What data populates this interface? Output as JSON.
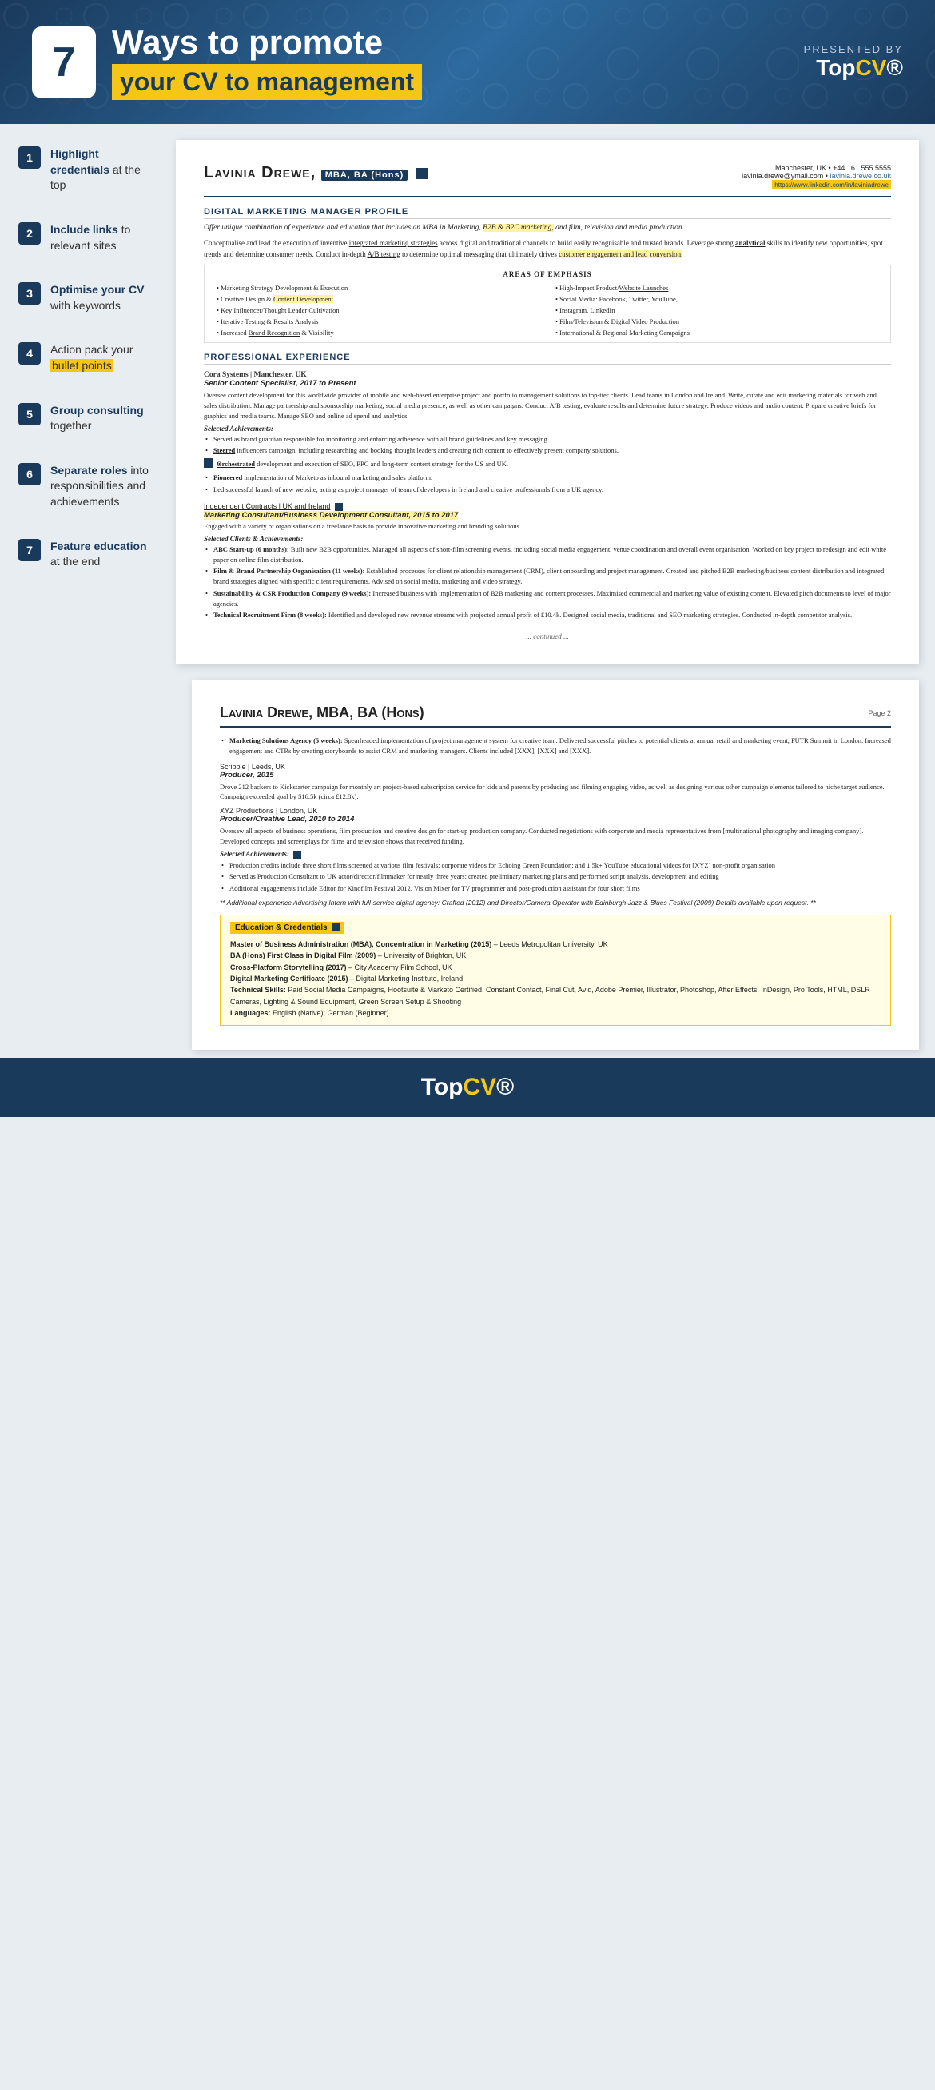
{
  "header": {
    "number": "7",
    "title": "Ways to promote",
    "subtitle": "your CV to management",
    "presented_by": "PRESENTED BY",
    "logo": "TopCV"
  },
  "tips": [
    {
      "number": "1",
      "text_prefix": "Highlight credentials",
      "text_suffix": " at the top"
    },
    {
      "number": "2",
      "text_prefix": "Include links",
      "text_suffix": " to relevant sites"
    },
    {
      "number": "3",
      "text_prefix": "Optimise your CV",
      "text_suffix": " with keywords"
    },
    {
      "number": "4",
      "text_prefix": "Action pack your ",
      "text_highlight": "bullet points"
    },
    {
      "number": "5",
      "text_prefix": "Group consulting",
      "text_suffix": " together"
    },
    {
      "number": "6",
      "text_prefix": "Separate roles",
      "text_suffix": " into responsibilities and achievements"
    },
    {
      "number": "7",
      "text_prefix": "Feature education",
      "text_suffix": " at the end"
    }
  ],
  "cv_page1": {
    "name_part1": "Lavinia Drewe,",
    "name_mba": "MBA, BA (Hons)",
    "contact_line1": "Manchester, UK • +44 161 555 5555",
    "contact_line2": "lavinia.drewe@ymail.com •",
    "contact_link1": "lavinia.drewe.co.uk",
    "contact_link2": "https://www.linkedin.com/in/laviniadrewe",
    "profile_title": "DIGITAL MARKETING MANAGER PROFILE",
    "profile_intro": "Offer unique combination of experience and education that includes an MBA in Marketing, B2B & B2C marketing, and film, television and media production.",
    "profile_body": "Conceptualise and lead the execution of inventive integrated marketing strategies across digital and traditional channels to build easily recognisable and trusted brands. Leverage strong analytical skills to identify new opportunities, spot trends and determine consumer needs. Conduct in-depth A/B testing to determine optimal messaging that ultimately drives customer engagement and lead conversion.",
    "areas_title": "Areas of Emphasis",
    "areas": [
      "Marketing Strategy Development & Execution",
      "High-Impact Product/Website Launches",
      "Creative Design & Content Development",
      "Social Media: Facebook, Twitter, YouTube,",
      "Key Influencer/Thought Leader Cultivation",
      "Instagram, LinkedIn",
      "Iterative Testing & Results Analysis",
      "Film/Television & Digital Video Production",
      "Increased Brand Recognition & Visibility",
      "International & Regional Marketing Campaigns"
    ],
    "prof_exp_title": "Professional Experience",
    "job1_company": "Cora Systems | Manchester, UK",
    "job1_title": "Senior Content Specialist, 2017 to Present",
    "job1_desc": "Oversee content development for this worldwide provider of mobile and web-based enterprise project and portfolio management solutions to top-tier clients. Lead teams in London and Ireland. Write, curate and edit marketing materials for web and sales distribution. Manage partnership and sponsorship marketing, social media presence, as well as other campaigns. Conduct A/B testing, evaluate results and determine future strategy. Produce videos and audio content. Prepare creative briefs for graphics and media teams. Manage SEO and online ad spend and analytics.",
    "job1_achievements_label": "Selected Achievements:",
    "job1_achievements": [
      "Served as brand guardian responsible for monitoring and enforcing adherence with all brand guidelines and key messaging.",
      "Steered influencers campaign, including researching and booking thought leaders and creating rich content to effectively present company solutions.",
      "Orchestrated development and execution of SEO, PPC and long-term content strategy for the US and UK.",
      "Pioneered implementation of Marketo as inbound marketing and sales platform.",
      "Led successful launch of new website, acting as project manager of team of developers in Ireland and creative professionals from a UK agency."
    ],
    "job2_location": "Independent Contracts | UK and Ireland",
    "job2_title": "Marketing Consultant/Business Development Consultant, 2015 to 2017",
    "job2_desc": "Engaged with a variety of organisations on a freelance basis to provide innovative marketing and branding solutions.",
    "job2_clients_label": "Selected Clients & Achievements:",
    "job2_clients": [
      "ABC Start-up (6 months): Built new B2B opportunities. Managed all aspects of short-film screening events, including social media engagement, venue coordination and overall event organisation. Worked on key project to redesign and edit white paper on online film distribution.",
      "Film & Brand Partnership Organisation (11 weeks): Established processes for client relationship management (CRM), client onboarding and project management. Created and pitched B2B marketing/business content distribution and integrated brand strategies aligned with specific client requirements. Advised on social media, marketing and video strategy.",
      "Sustainability & CSR Production Company (9 weeks): Increased business with implementation of B2B marketing and content processes. Maximised commercial and marketing value of existing content. Elevated pitch documents to level of major agencies.",
      "Technical Recruitment Firm (8 weeks): Identified and developed new revenue streams with projected annual profit of £10.4k. Designed social media, traditional and SEO marketing strategies. Conducted in-depth competitor analysis."
    ],
    "continued": "... continued ..."
  },
  "cv_page2": {
    "name": "Lavinia Drewe, MBA, BA (Hons)",
    "page_num": "Page 2",
    "job3_company": "Marketing Solutions Agency (5 weeks):",
    "job3_desc": "Spearheaded implementation of project management system for creative team. Delivered successful pitches to potential clients at annual retail and marketing event, FUTR Summit in London. Increased engagement and CTRs by creating storyboards to assist CRM and marketing managers. Clients included [XXX], [XXX] and [XXX].",
    "job4_company": "Scribble | Leeds, UK",
    "job4_title": "Producer, 2015",
    "job4_desc": "Drove 212 backers to Kickstarter campaign for monthly art project-based subscription service for kids and parents by producing and filming engaging video, as well as designing various other campaign elements tailored to niche target audience. Campaign exceeded goal by $16.5k (circa £12.8k).",
    "job5_company": "XYZ Productions | London, UK",
    "job5_title": "Producer/Creative Lead, 2010 to 2014",
    "job5_desc": "Oversaw all aspects of business operations, film production and creative design for start-up production company. Conducted negotiations with corporate and media representatives from [multinational photography and imaging company]. Developed concepts and screenplays for films and television shows that received funding.",
    "job5_achievements_label": "Selected Achievements:",
    "job5_achievements": [
      "Production credits include three short films screened at various film festivals; corporate videos for Echoing Green Foundation; and 1.5k+ YouTube educational videos for [XYZ] non-profit organisation",
      "Served as Production Consultant to UK actor/director/filmmaker for nearly three years; created preliminary marketing plans and performed script analysis, development and editing",
      "Additional engagements include Editor for Kinofilm Festival 2012, Vision Mixer for TV programmer and post-production assistant for four short films"
    ],
    "additional_note": "** Additional experience Advertising Intern with full-service digital agency: Crafted (2012) and Director/Camera Operator with Edinburgh Jazz & Blues Festival (2009) Details available upon request. **",
    "edu_title": "Education & Credentials",
    "edu_items": [
      "Master of Business Administration (MBA), Concentration in Marketing (2015) – Leeds Metropolitan University, UK",
      "BA (Hons) First Class in Digital Film (2009) – University of Brighton, UK",
      "Cross-Platform Storytelling (2017) – City Academy Film School, UK",
      "Digital Marketing Certificate (2015) – Digital Marketing Institute, Ireland",
      "Technical Skills: Paid Social Media Campaigns, Hootsuite & Marketo Certified, Constant Contact, Final Cut, Avid, Adobe Premier, Illustrator, Photoshop, After Effects, InDesign, Pro Tools, HTML, DSLR Cameras, Lighting & Sound Equipment, Green Screen Setup & Shooting",
      "Languages: English (Native); German (Beginner)"
    ]
  },
  "footer": {
    "logo": "TopCV"
  }
}
